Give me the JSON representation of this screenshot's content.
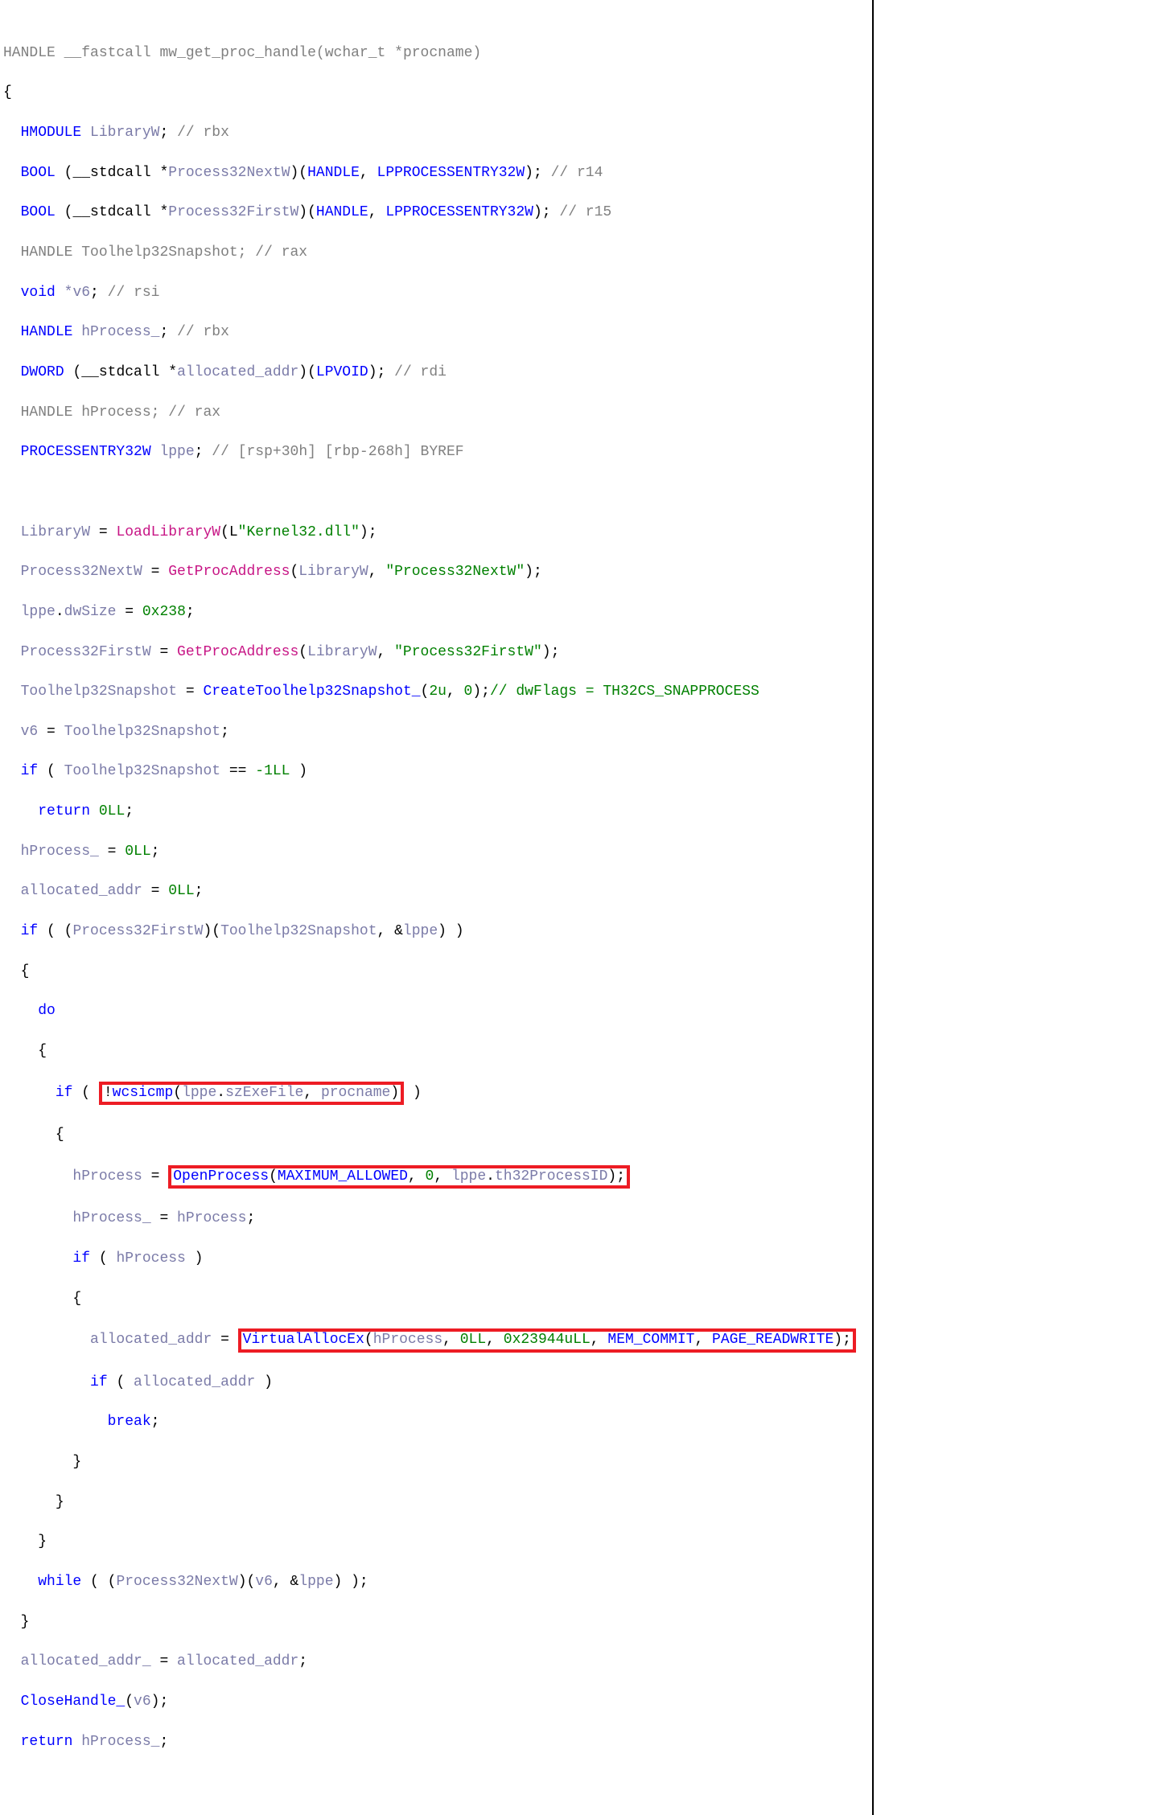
{
  "line1": {
    "type": "HANDLE",
    "cc": "__fastcall",
    "fn": "mw_get_proc_handle",
    "pt": "wchar_t",
    "pn": "procname"
  },
  "line2": {
    "o": "{"
  },
  "line3": {
    "t": "HMODULE",
    "v": "LibraryW",
    "s": ";",
    "c": "// rbx"
  },
  "line4": {
    "t": "BOOL",
    "pre": "(__stdcall *",
    "v": "Process32NextW",
    "post": ")(",
    "a1t": "HANDLE",
    "a2t": "LPPROCESSENTRY32W",
    "end": ");",
    "c": "// r14"
  },
  "line5": {
    "t": "BOOL",
    "pre": "(__stdcall *",
    "v": "Process32FirstW",
    "post": ")(",
    "a1t": "HANDLE",
    "a2t": "LPPROCESSENTRY32W",
    "end": ");",
    "c": "// r15"
  },
  "line6": {
    "t": "HANDLE",
    "v": "Toolhelp32Snapshot",
    "s": ";",
    "c": "// rax"
  },
  "line7": {
    "t": "void",
    "v": "*v6",
    "s": ";",
    "c": "// rsi"
  },
  "line8": {
    "t": "HANDLE",
    "v": "hProcess_",
    "s": ";",
    "c": "// rbx"
  },
  "line9": {
    "t": "DWORD",
    "pre": "(__stdcall *",
    "v": "allocated_addr",
    "post": ")(",
    "a1t": "LPVOID",
    "end": ");",
    "c": "// rdi"
  },
  "line10": {
    "t": "HANDLE",
    "v": "hProcess",
    "s": ";",
    "c": "// rax"
  },
  "line11": {
    "t": "PROCESSENTRY32W",
    "v": "lppe",
    "s": ";",
    "c": "// [rsp+30h] [rbp-268h] BYREF"
  },
  "line13": {
    "v": "LibraryW",
    "eq": " = ",
    "fn": "LoadLibraryW",
    "o": "(L",
    "str": "\"Kernel32.dll\"",
    "c": ");"
  },
  "line14": {
    "v": "Process32NextW",
    "eq": " = ",
    "fn": "GetProcAddress",
    "o": "(",
    "a1": "LibraryW",
    "sep": ", ",
    "str": "\"Process32NextW\"",
    "c": ");"
  },
  "line15": {
    "v": "lppe",
    "d": ".",
    "m": "dwSize",
    "eq": " = ",
    "n": "0x238",
    "s": ";"
  },
  "line16": {
    "v": "Process32FirstW",
    "eq": " = ",
    "fn": "GetProcAddress",
    "o": "(",
    "a1": "LibraryW",
    "sep": ", ",
    "str": "\"Process32FirstW\"",
    "c": ");"
  },
  "line17": {
    "v": "Toolhelp32Snapshot",
    "eq": " = ",
    "fn": "CreateToolhelp32Snapshot_",
    "o": "(",
    "n1": "2u",
    "sep": ", ",
    "n2": "0",
    "c": ");",
    "cmt": "// dwFlags = TH32CS_SNAPPROCESS"
  },
  "line18": {
    "v1": "v6",
    "eq": " = ",
    "v2": "Toolhelp32Snapshot",
    "s": ";"
  },
  "line19": {
    "kw": "if",
    "o": " ( ",
    "v": "Toolhelp32Snapshot",
    "op": " == ",
    "n": "-1LL",
    "c": " )"
  },
  "line20": {
    "kw": "return",
    "sp": " ",
    "n": "0LL",
    "s": ";"
  },
  "line21": {
    "v": "hProcess_",
    "eq": " = ",
    "n": "0LL",
    "s": ";"
  },
  "line22": {
    "v": "allocated_addr",
    "eq": " = ",
    "n": "0LL",
    "s": ";"
  },
  "line23": {
    "kw": "if",
    "o": " ( (",
    "fn": "Process32FirstW",
    "m": ")(",
    "a1": "Toolhelp32Snapshot",
    "sep": ", &",
    "a2": "lppe",
    "c": ") )"
  },
  "line24": {
    "o": "{"
  },
  "line25": {
    "kw": "do"
  },
  "line26": {
    "o": "{"
  },
  "line27": {
    "kw": "if",
    "o": " ( ",
    "neg": "!",
    "fn": "wcsicmp",
    "op": "(",
    "a1": "lppe",
    "d": ".",
    "m": "szExeFile",
    "sep": ", ",
    "a2": "procname",
    "cp": ")",
    "c": " )"
  },
  "line28": {
    "o": "{"
  },
  "line29": {
    "v": "hProcess",
    "eq": " = ",
    "fn": "OpenProcess",
    "o": "(",
    "a1": "MAXIMUM_ALLOWED",
    "s1": ", ",
    "n": "0",
    "s2": ", ",
    "a2": "lppe",
    "d": ".",
    "m": "th32ProcessID",
    "c": ");"
  },
  "line30": {
    "v1": "hProcess_",
    "eq": " = ",
    "v2": "hProcess",
    "s": ";"
  },
  "line31": {
    "kw": "if",
    "o": " ( ",
    "v": "hProcess",
    "c": " )"
  },
  "line32": {
    "o": "{"
  },
  "line33": {
    "v": "allocated_addr",
    "eq": " = ",
    "fn": "VirtualAllocEx",
    "o": "(",
    "a1": "hProcess",
    "s1": ", ",
    "n1": "0LL",
    "s2": ", ",
    "n2": "0x23944uLL",
    "s3": ", ",
    "a2": "MEM_COMMIT",
    "s4": ", ",
    "a3": "PAGE_READWRITE",
    "c": ");"
  },
  "line34": {
    "kw": "if",
    "o": " ( ",
    "v": "allocated_addr",
    "c": " )"
  },
  "line35": {
    "kw": "break",
    "s": ";"
  },
  "line36": {
    "o": "}"
  },
  "line37": {
    "o": "}"
  },
  "line38": {
    "o": "}"
  },
  "line39": {
    "kw": "while",
    "o": " ( (",
    "fn": "Process32NextW",
    "m": ")(",
    "a1": "v6",
    "sep": ", &",
    "a2": "lppe",
    "c": ") );"
  },
  "line40": {
    "o": "}"
  },
  "line41": {
    "v1": "allocated_addr_",
    "eq": " = ",
    "v2": "allocated_addr",
    "s": ";"
  },
  "line42": {
    "fn": "CloseHandle_",
    "o": "(",
    "a1": "v6",
    "c": ");"
  },
  "line43": {
    "kw": "return",
    "sp": " ",
    "v": "hProcess_",
    "s": ";"
  }
}
